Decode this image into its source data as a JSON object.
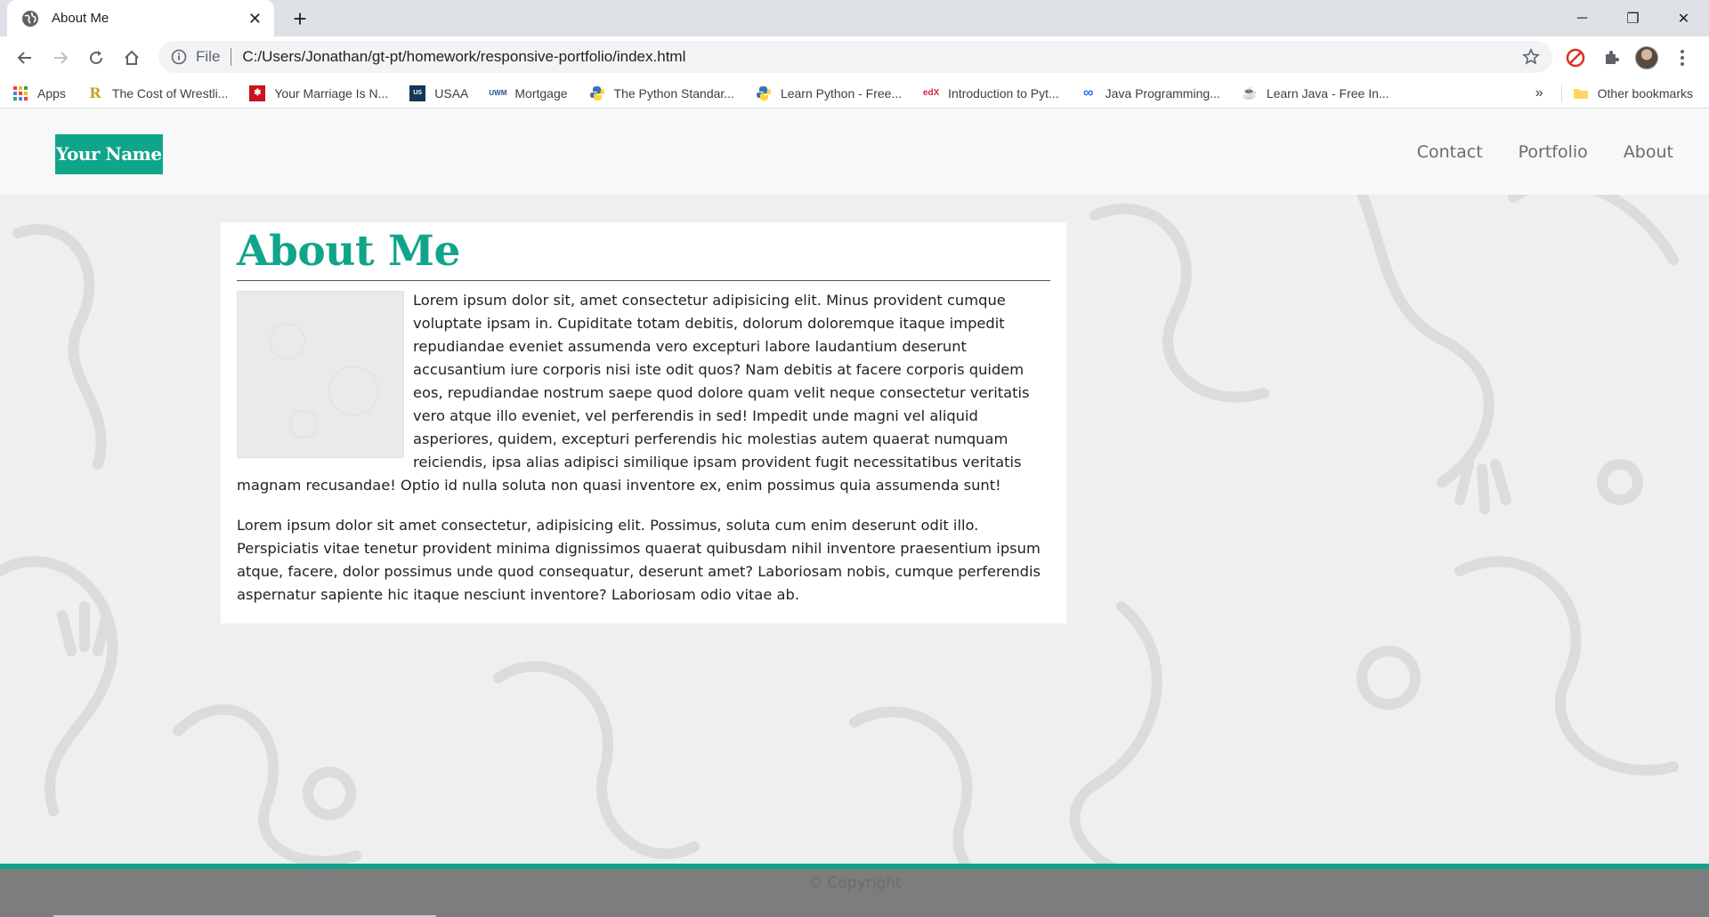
{
  "browser": {
    "tab_title": "About Me",
    "tab_close": "✕",
    "new_tab": "+",
    "window_controls": {
      "minimize": "─",
      "restore": "❐",
      "close": "✕"
    },
    "omnibox": {
      "scheme": "File",
      "url": "C:/Users/Jonathan/gt-pt/homework/responsive-portfolio/index.html"
    },
    "bookmarks": [
      {
        "label": "Apps",
        "icon": "apps-grid-icon",
        "color": "#e94235"
      },
      {
        "label": "The Cost of Wrestli...",
        "icon": "r-logo-icon",
        "color": "#c9a227"
      },
      {
        "label": "Your Marriage Is N...",
        "icon": "red-square-icon",
        "color": "#c4161c"
      },
      {
        "label": "USAA",
        "icon": "usaa-icon",
        "color": "#12395b"
      },
      {
        "label": "Mortgage",
        "icon": "uwm-icon",
        "color": "#1f4e9c"
      },
      {
        "label": "The Python Standar...",
        "icon": "python-icon",
        "color": "#3776ab"
      },
      {
        "label": "Learn Python - Free...",
        "icon": "python-icon",
        "color": "#3776ab"
      },
      {
        "label": "Introduction to Pyt...",
        "icon": "edx-icon",
        "color": "#d0263e"
      },
      {
        "label": "Java Programming...",
        "icon": "infinity-icon",
        "color": "#1a73e8"
      },
      {
        "label": "Learn Java - Free In...",
        "icon": "java-icon",
        "color": "#e76f00"
      }
    ],
    "bookmarks_more": "»",
    "other_bookmarks": "Other bookmarks"
  },
  "site": {
    "logo": "Your Name",
    "nav": [
      "Contact",
      "Portfolio",
      "About"
    ],
    "heading": "About Me",
    "paragraph1": "Lorem ipsum dolor sit, amet consectetur adipisicing elit. Minus provident cumque voluptate ipsam in. Cupiditate totam debitis, dolorum doloremque itaque impedit repudiandae eveniet assumenda vero excepturi labore laudantium deserunt accusantium iure corporis nisi iste odit quos? Nam debitis at facere corporis quidem eos, repudiandae nostrum saepe quod dolore quam velit neque consectetur veritatis vero atque illo eveniet, vel perferendis in sed! Impedit unde magni vel aliquid asperiores, quidem, excepturi perferendis hic molestias autem quaerat numquam reiciendis, ipsa alias adipisci similique ipsam provident fugit necessitatibus veritatis magnam recusandae! Optio id nulla soluta non quasi inventore ex, enim possimus quia assumenda sunt!",
    "paragraph2": "Lorem ipsum dolor sit amet consectetur, adipisicing elit. Possimus, soluta cum enim deserunt odit illo. Perspiciatis vitae tenetur provident minima dignissimos quaerat quibusdam nihil inventore praesentium ipsum atque, facere, dolor possimus unde quod consequatur, deserunt amet? Laboriosam nobis, cumque perferendis aspernatur sapiente hic itaque nesciunt inventore? Laboriosam odio vitae ab.",
    "footer": "© Copyright"
  },
  "colors": {
    "accent": "#10a58a",
    "footer_bg": "#7d7d7d",
    "page_bg": "#efefef"
  }
}
